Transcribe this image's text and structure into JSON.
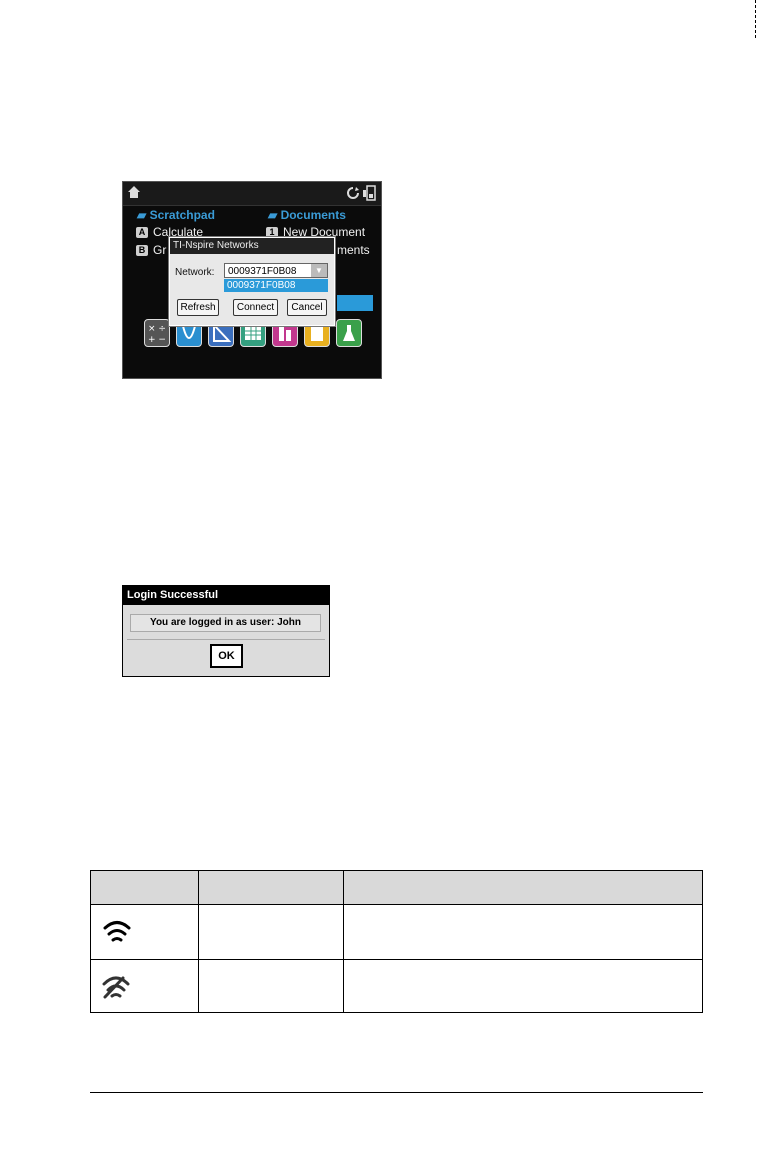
{
  "home_screen": {
    "scratchpad": "Scratchpad",
    "documents": "Documents",
    "rows": [
      {
        "key": "A",
        "label": "Calculate"
      },
      {
        "key": "B",
        "label": "Gr"
      }
    ],
    "doc_rows": [
      {
        "key": "1",
        "label": "New Document"
      },
      {
        "label": "ments"
      }
    ],
    "app_icons": [
      "calculator-icon",
      "graphs-icon",
      "geometry-icon",
      "lists-spreadsheet-icon",
      "data-statistics-icon",
      "notes-icon",
      "vernier-dataquest-icon"
    ]
  },
  "network_dialog": {
    "title": "TI-Nspire Networks",
    "network_label": "Network:",
    "selected_network": "0009371F0B08",
    "dropdown_option": "0009371F0B08",
    "buttons": {
      "refresh": "Refresh",
      "connect": "Connect",
      "cancel": "Cancel"
    }
  },
  "login_dialog": {
    "title": "Login Successful",
    "message": "You are logged in as user: John",
    "ok": "OK"
  },
  "colors": {
    "screen_bg": "#0b0b0b",
    "highlight_blue": "#2a9ad9",
    "table_header": "#d9d9d9"
  }
}
